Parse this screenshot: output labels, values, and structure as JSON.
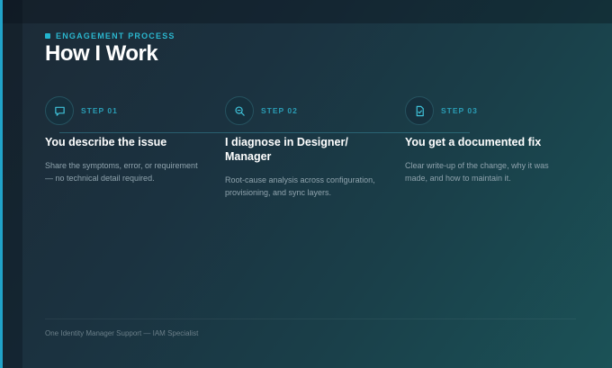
{
  "header": {
    "eyebrow": "ENGAGEMENT PROCESS",
    "title": "How I Work"
  },
  "steps": [
    {
      "number": "STEP 01",
      "title": "You describe the issue",
      "description": "Share the symptoms, error, or requirement — no technical detail required.",
      "icon": "message-icon"
    },
    {
      "number": "STEP 02",
      "title": "I diagnose in Designer/ Manager",
      "description": "Root-cause analysis across configuration, provisioning, and sync layers.",
      "icon": "search-icon"
    },
    {
      "number": "STEP 03",
      "title": "You get a documented fix",
      "description": "Clear write-up of the change, why it was made, and how to maintain it.",
      "icon": "document-check-icon"
    }
  ],
  "footer": {
    "text": "One Identity Manager Support — IAM Specialist"
  },
  "colors": {
    "accent": "#22b5cf",
    "background": "#1b3240"
  }
}
